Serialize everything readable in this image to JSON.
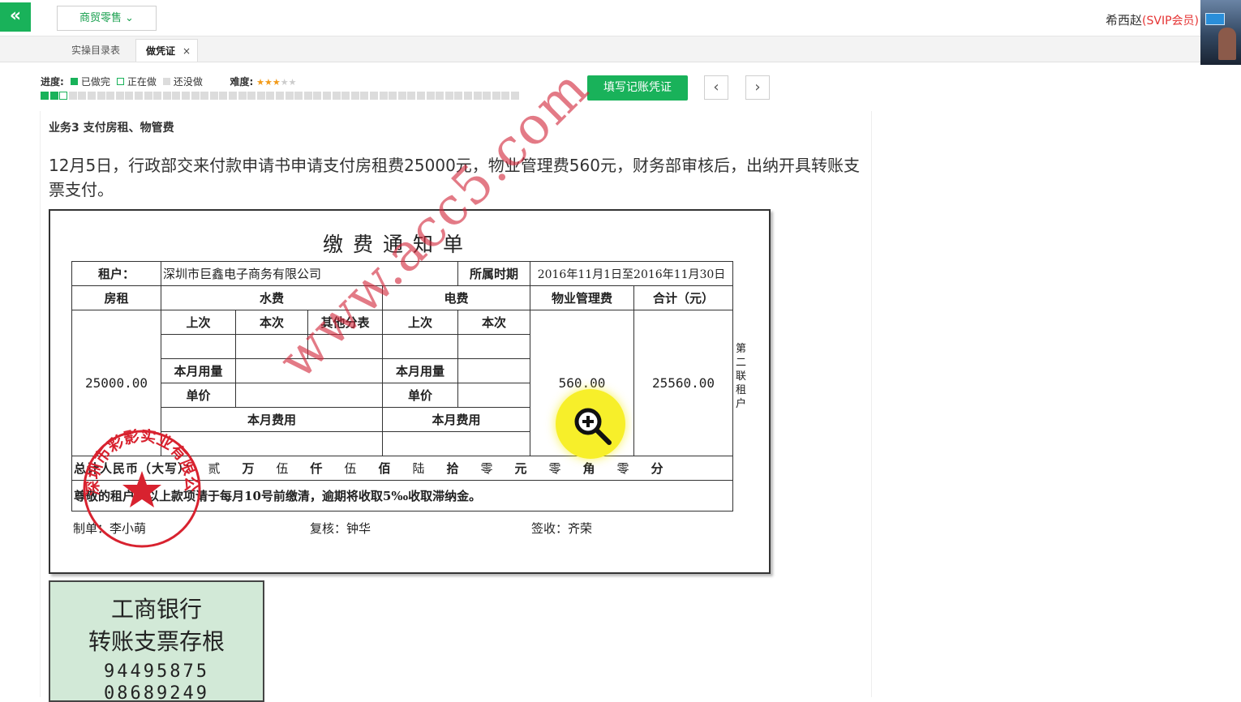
{
  "topbar": {
    "back_icon": "«",
    "module": "商贸零售",
    "user_name": "希西赵",
    "user_vip": "(SVIP会员)"
  },
  "tabs": [
    {
      "label": "实操目录表"
    },
    {
      "label": "做凭证",
      "close": "×"
    }
  ],
  "progress": {
    "label": "进度:",
    "done": "已做完",
    "doing": "正在做",
    "todo": "还没做",
    "difficulty_label": "难度:",
    "difficulty_stars": 3,
    "difficulty_max": 5,
    "completed_steps": 2,
    "current_step": 3,
    "total_steps": 51,
    "colors": {
      "done": "#19b25a",
      "todo": "#dcdcdc"
    }
  },
  "toolbar": {
    "fill_button": "填写记账凭证",
    "prev_icon": "‹",
    "next_icon": "›"
  },
  "business": {
    "title": "业务3 支付房租、物管费",
    "description": "12月5日，行政部交来付款申请书申请支付房租费25000元，物业管理费560元，财务部审核后，出纳开具转账支票支付。"
  },
  "notice": {
    "title": "缴费通知单",
    "tenant_label": "租户：",
    "tenant": "深圳市巨鑫电子商务有限公司",
    "period_label": "所属时期",
    "period": "2016年11月1日至2016年11月30日",
    "headers": {
      "rent": "房租",
      "water": "水费",
      "electric": "电费",
      "property": "物业管理费",
      "total": "合计（元）"
    },
    "sub": {
      "last": "上次",
      "this": "本次",
      "other_meter": "其他分表",
      "usage": "本月用量",
      "price": "单价",
      "fee": "本月费用"
    },
    "rent_amount": "25000.00",
    "property_amount": "560.00",
    "total_amount": "25560.00",
    "total_label": "总计人民币（大写）：",
    "total_upper": [
      {
        "d": "贰",
        "u": "万"
      },
      {
        "d": "伍",
        "u": "仟"
      },
      {
        "d": "伍",
        "u": "佰"
      },
      {
        "d": "陆",
        "u": "拾"
      },
      {
        "d": "零",
        "u": "元"
      },
      {
        "d": "零",
        "u": "角"
      },
      {
        "d": "零",
        "u": "分"
      }
    ],
    "remark": "尊敬的租户，以上款项请于每月10号前缴清，逾期将收取5‰收取滞纳金。",
    "side_note": "第二联 租户",
    "maker": "制单：李小萌",
    "reviewer": "复核：钟华",
    "receiver": "签收：齐荣",
    "watermark": "www.acc5.com",
    "stamp_text": "深圳市彩影实业有限公司"
  },
  "check_stub": {
    "bank": "工商银行",
    "title": "转账支票存根",
    "number1": "94495875",
    "number2": "08689249"
  }
}
